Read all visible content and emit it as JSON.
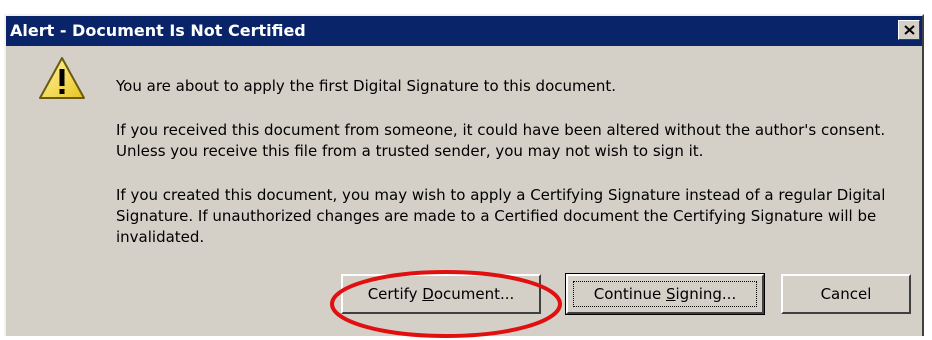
{
  "dialog": {
    "title": "Alert - Document Is Not Certified",
    "icon": "warning-icon",
    "message_1": "You are about to apply the first Digital Signature to this document.",
    "message_2": "If you received this document from someone, it could have been altered without the author's consent. Unless you receive this file from a trusted sender, you may not wish to sign it.",
    "message_3": "If you created this document, you may wish to apply a Certifying Signature instead of a regular Digital Signature. If unauthorized changes are made to a Certified document the Certifying Signature will be invalidated.",
    "buttons": {
      "certify_pre": "Certify ",
      "certify_mnemonic": "D",
      "certify_post": "ocument...",
      "continue_pre": "Continue ",
      "continue_mnemonic": "S",
      "continue_post": "igning...",
      "cancel": "Cancel"
    },
    "highlight_color": "#e01010",
    "titlebar_color": "#0a246a",
    "face_color": "#d4d0c8"
  }
}
